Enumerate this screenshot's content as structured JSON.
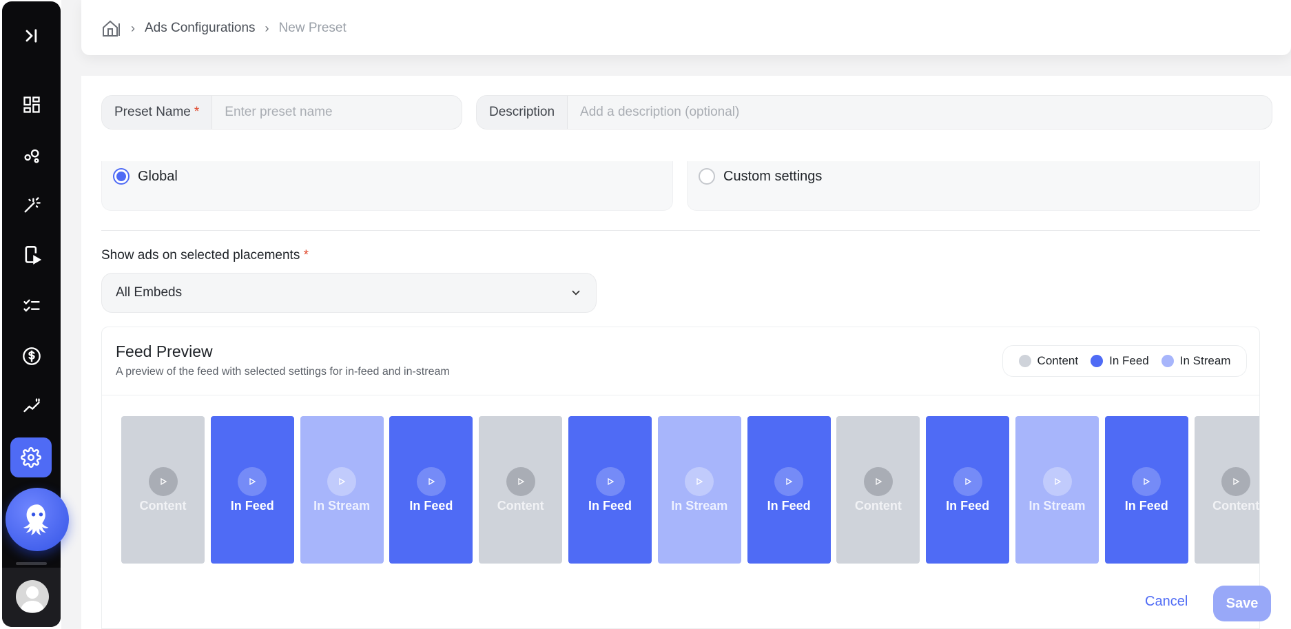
{
  "breadcrumb": {
    "home_icon": "home-icon",
    "items": [
      "Ads Configurations",
      "New Preset"
    ]
  },
  "form": {
    "preset_name": {
      "label": "Preset Name",
      "required_mark": "*",
      "placeholder": "Enter preset name",
      "value": ""
    },
    "description": {
      "label": "Description",
      "placeholder": "Add a description (optional)",
      "value": ""
    },
    "scope": {
      "options": [
        {
          "label": "Global",
          "selected": true
        },
        {
          "label": "Custom settings",
          "selected": false
        }
      ]
    },
    "placements": {
      "label": "Show ads on selected placements",
      "required_mark": "*",
      "selected": "All Embeds"
    }
  },
  "preview": {
    "title": "Feed Preview",
    "subtitle": "A preview of the feed with selected settings for in-feed and in-stream",
    "legend": [
      {
        "label": "Content",
        "color": "#cfd3da"
      },
      {
        "label": "In Feed",
        "color": "#4f6bf5"
      },
      {
        "label": "In Stream",
        "color": "#a7b5fb"
      }
    ],
    "tiles": [
      "Content",
      "In Feed",
      "In Stream",
      "In Feed",
      "Content",
      "In Feed",
      "In Stream",
      "In Feed",
      "Content",
      "In Feed",
      "In Stream",
      "In Feed",
      "Content"
    ]
  },
  "actions": {
    "cancel": "Cancel",
    "save": "Save"
  },
  "colors": {
    "accent": "#4f6bf5",
    "sidebar_bg": "#0b0b0d",
    "required": "#e0482c"
  }
}
